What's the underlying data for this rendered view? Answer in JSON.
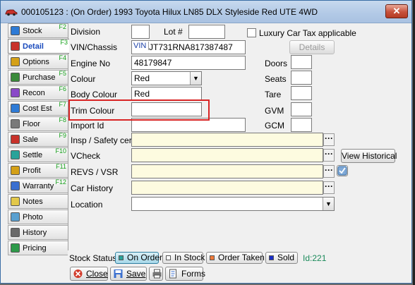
{
  "window": {
    "title": "000105123 : (On Order) 1993 Toyota Hilux LN85 DLX Styleside Red UTE 4WD",
    "close_symbol": "✕"
  },
  "tabs": [
    {
      "label": "Stock",
      "fkey": "F2",
      "icon": "stock-icon"
    },
    {
      "label": "Detail",
      "fkey": "F3",
      "icon": "detail-icon",
      "active": true
    },
    {
      "label": "Options",
      "fkey": "F4",
      "icon": "options-icon"
    },
    {
      "label": "Purchase",
      "fkey": "F5",
      "icon": "purchase-icon"
    },
    {
      "label": "Recon",
      "fkey": "F6",
      "icon": "recon-icon"
    },
    {
      "label": "Cost Est",
      "fkey": "F7",
      "icon": "cost-est-icon"
    },
    {
      "label": "Floor",
      "fkey": "F8",
      "icon": "floor-icon"
    },
    {
      "label": "Sale",
      "fkey": "F9",
      "icon": "sale-icon"
    },
    {
      "label": "Settle",
      "fkey": "F10",
      "icon": "settle-icon"
    },
    {
      "label": "Profit",
      "fkey": "F11",
      "icon": "profit-icon"
    },
    {
      "label": "Warranty",
      "fkey": "F12",
      "icon": "warranty-icon"
    },
    {
      "label": "Notes",
      "fkey": "",
      "icon": "notes-icon"
    },
    {
      "label": "Photo",
      "fkey": "",
      "icon": "photo-icon"
    },
    {
      "label": "History",
      "fkey": "",
      "icon": "history-icon"
    },
    {
      "label": "Pricing",
      "fkey": "",
      "icon": "pricing-icon"
    }
  ],
  "form": {
    "division_label": "Division",
    "division_value": "",
    "lot_label": "Lot #",
    "lot_value": "",
    "luxury_tax_label": "Luxury Car Tax applicable",
    "details_button": "Details",
    "vin_label": "VIN/Chassis",
    "vin_tag": "VIN",
    "vin_value": "JT731RNA817387487",
    "engine_label": "Engine No",
    "engine_value": "48179847",
    "colour_label": "Colour",
    "colour_value": "Red",
    "body_colour_label": "Body Colour",
    "body_colour_value": "Red",
    "trim_colour_label": "Trim Colour",
    "trim_colour_value": "",
    "import_id_label": "Import Id",
    "import_id_value": "",
    "doors_label": "Doors",
    "seats_label": "Seats",
    "tare_label": "Tare",
    "gvm_label": "GVM",
    "gcm_label": "GCM",
    "insp_label": "Insp / Safety cert",
    "vcheck_label": "VCheck",
    "view_historical_button": "View Historical",
    "revs_label": "REVS / VSR",
    "car_history_label": "Car History",
    "location_label": "Location",
    "location_value": "",
    "dots": "···"
  },
  "status": {
    "label": "Stock Status",
    "options": [
      {
        "label": "On Order",
        "color": "#2aa39a",
        "selected": true
      },
      {
        "label": "In Stock",
        "color": "#ffffff"
      },
      {
        "label": "Order Taken",
        "color": "#f07a3a"
      },
      {
        "label": "Sold",
        "color": "#1a2fc8"
      }
    ],
    "id_text": "Id:221"
  },
  "buttons": {
    "close": "Close",
    "save": "Save",
    "forms": "Forms"
  },
  "colors": {
    "accent_tab": "#1a4bbd",
    "fkey": "#15a01a",
    "highlight": "#d82424"
  }
}
